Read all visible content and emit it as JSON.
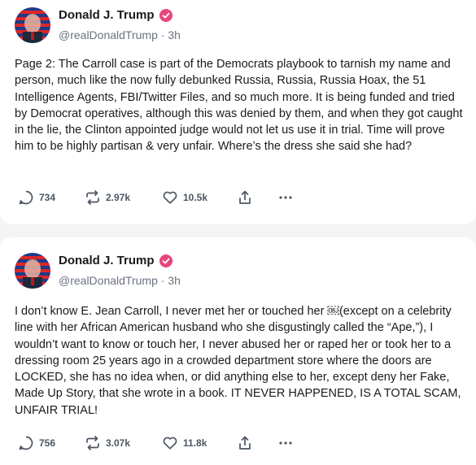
{
  "colors": {
    "verified": "#e8467a",
    "text": "#1a1a1a",
    "muted": "#6b7280",
    "action": "#4b5563"
  },
  "posts": [
    {
      "author_name": "Donald J. Trump",
      "handle": "@realDonaldTrump",
      "separator": "·",
      "time": "3h",
      "text": "Page 2: The Carroll case is part of the Democrats playbook to tarnish my name and person, much like the now fully debunked Russia, Russia, Russia Hoax, the 51 Intelligence Agents, FBI/Twitter Files, and so much more. It is being funded and tried by Democrat operatives, although this was denied by them, and when they got caught in the lie, the Clinton appointed judge would not let us use it in trial. Time will prove him to be highly partisan & very unfair. Where’s the dress she said she had?",
      "replies": "734",
      "retruths": "2.97k",
      "likes": "10.5k",
      "icons": [
        "reply-icon",
        "retruth-icon",
        "heart-icon",
        "share-icon",
        "more-icon"
      ]
    },
    {
      "author_name": "Donald J. Trump",
      "handle": "@realDonaldTrump",
      "separator": "·",
      "time": "3h",
      "text": "I don’t know E. Jean Carroll, I never met her or touched her ￼(except on a celebrity line with her African American husband who she disgustingly called the “Ape,”), I wouldn’t want to know or touch her, I never abused her or raped her or took her to a dressing room 25 years ago in a crowded department store where the doors are LOCKED, she has no idea when, or did anything else to her, except deny her Fake, Made Up Story, that she wrote in a book. IT NEVER HAPPENED, IS A TOTAL SCAM, UNFAIR TRIAL!",
      "replies": "756",
      "retruths": "3.07k",
      "likes": "11.8k",
      "icons": [
        "reply-icon",
        "retruth-icon",
        "heart-icon",
        "share-icon",
        "more-icon"
      ]
    }
  ]
}
